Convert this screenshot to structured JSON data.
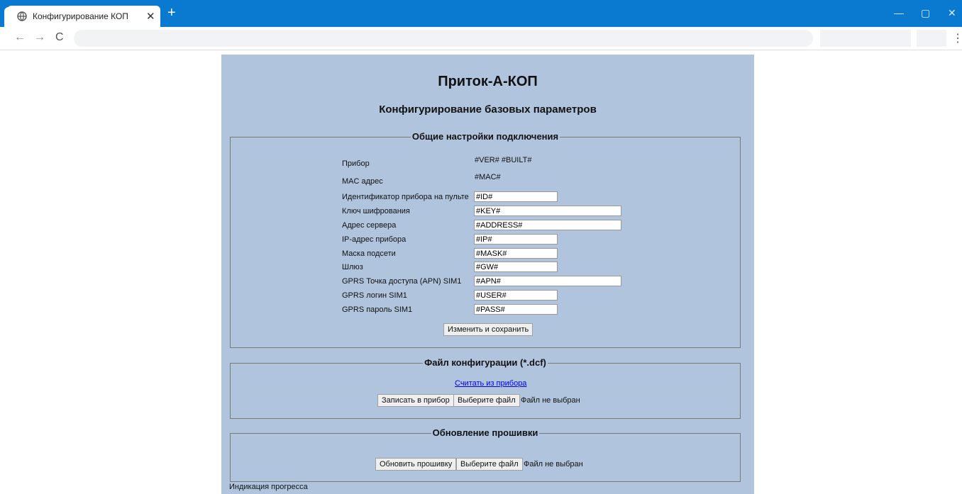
{
  "browser": {
    "tab_title": "Конфигурирование КОП",
    "close_glyph": "✕",
    "new_tab_glyph": "+",
    "back_glyph": "←",
    "forward_glyph": "→",
    "reload_glyph": "C",
    "menu_glyph": "⋮",
    "minimize_glyph": "—",
    "maximize_glyph": "▢",
    "window_close_glyph": "✕",
    "accent_color": "#0a7ad1"
  },
  "page": {
    "title": "Приток-А-КОП",
    "subtitle": "Конфигурирование базовых параметров",
    "background_color": "#b0c4de"
  },
  "general": {
    "legend": "Общие настройки подключения",
    "device_label": "Прибор",
    "device_value": "#VER# #BUILT#",
    "mac_label": "MAC адрес",
    "mac_value": "#MAC#",
    "id_label": "Идентификатор прибора на пульте",
    "id_value": "#ID#",
    "key_label": "Ключ шифрования",
    "key_value": "#KEY#",
    "address_label": "Адрес сервера",
    "address_value": "#ADDRESS#",
    "ip_label": "IP-адрес прибора",
    "ip_value": "#IP#",
    "mask_label": "Маска подсети",
    "mask_value": "#MASK#",
    "gw_label": "Шлюз",
    "gw_value": "#GW#",
    "apn_label": "GPRS Точка доступа (APN) SIM1",
    "apn_value": "#APN#",
    "user_label": "GPRS логин SIM1",
    "user_value": "#USER#",
    "pass_label": "GPRS пароль SIM1",
    "pass_value": "#PASS#",
    "save_button": "Изменить и сохранить"
  },
  "config_file": {
    "legend": "Файл конфигурации (*.dcf)",
    "read_link": "Считать из прибора",
    "write_button": "Записать в прибор",
    "choose_button": "Выберите файл",
    "no_file": "Файл не выбран"
  },
  "firmware": {
    "legend": "Обновление прошивки",
    "update_button": "Обновить прошивку",
    "choose_button": "Выберите файл",
    "no_file": "Файл не выбран"
  },
  "progress_label": "Индикация прогресса"
}
